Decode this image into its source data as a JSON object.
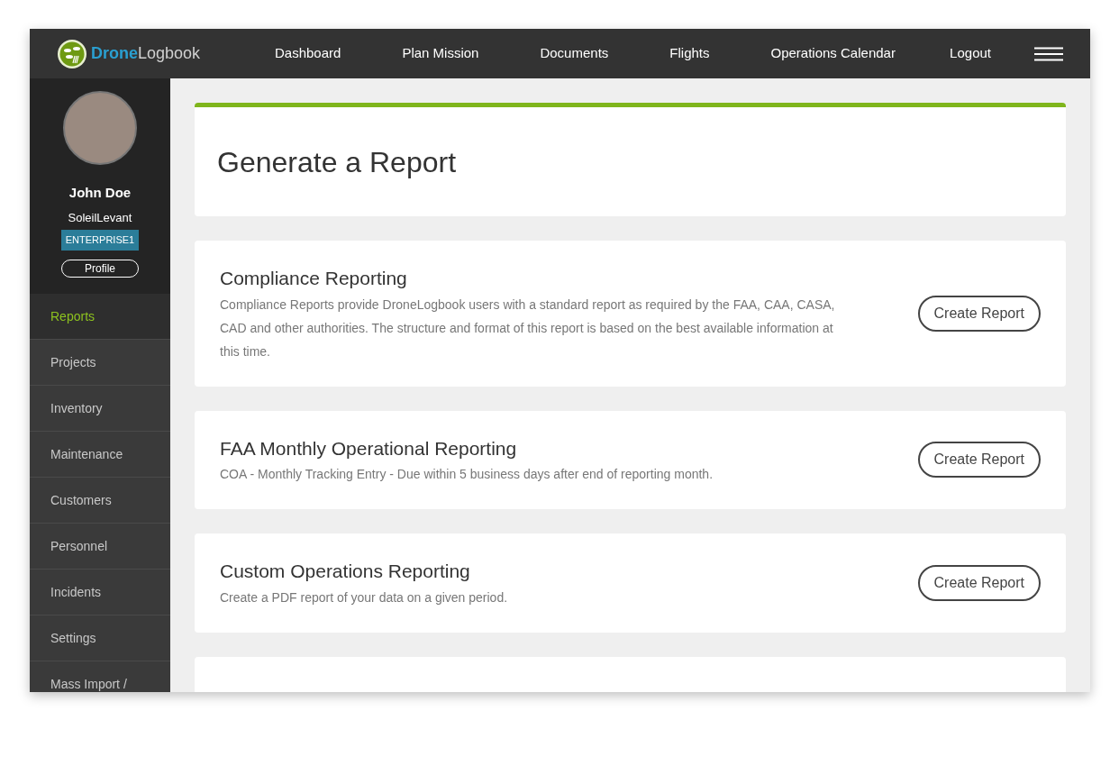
{
  "logo": {
    "brand_first": "Drone",
    "brand_second": "Logbook"
  },
  "nav": [
    {
      "label": "Dashboard"
    },
    {
      "label": "Plan Mission"
    },
    {
      "label": "Documents"
    },
    {
      "label": "Flights"
    },
    {
      "label": "Operations Calendar"
    }
  ],
  "logout": "Logout",
  "user": {
    "name": "John Doe",
    "username": "SoleilLevant",
    "plan": "ENTERPRISE1",
    "profile_button": "Profile"
  },
  "sidebar": {
    "items": [
      {
        "label": "Reports",
        "selected": true
      },
      {
        "label": "Projects",
        "selected": false
      },
      {
        "label": "Inventory",
        "selected": false
      },
      {
        "label": "Maintenance",
        "selected": false
      },
      {
        "label": "Customers",
        "selected": false
      },
      {
        "label": "Personnel",
        "selected": false
      },
      {
        "label": "Incidents",
        "selected": false
      },
      {
        "label": "Settings",
        "selected": false
      },
      {
        "label": "Mass Import /",
        "selected": false
      }
    ]
  },
  "page_title": "Generate a Report",
  "reports": [
    {
      "title": "Compliance Reporting",
      "description": "Compliance Reports provide DroneLogbook users with a standard report as required by the FAA, CAA, CASA, CAD and other authorities. The structure and format of this report is based on the best available information at this time.",
      "button": "Create Report"
    },
    {
      "title": "FAA Monthly Operational Reporting",
      "description": "COA - Monthly Tracking Entry - Due within 5 business days after end of reporting month.",
      "button": "Create Report"
    },
    {
      "title": "Custom Operations Reporting",
      "description": "Create a PDF report of your data on a given period.",
      "button": "Create Report"
    }
  ]
}
